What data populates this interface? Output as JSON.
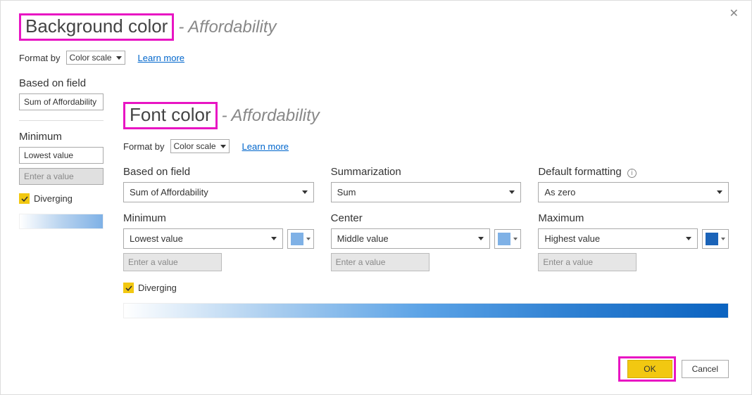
{
  "back": {
    "title_main": "Background color",
    "title_sub": "- Affordability",
    "format_by_label": "Format by",
    "format_by_value": "Color scale",
    "learn_more": "Learn more",
    "based_on_field_label": "Based on field",
    "based_on_field_value": "Sum of Affordability",
    "minimum_label": "Minimum",
    "minimum_value": "Lowest value",
    "minimum_placeholder": "Enter a value",
    "diverging_label": "Diverging"
  },
  "front": {
    "title_main": "Font color",
    "title_sub": "- Affordability",
    "format_by_label": "Format by",
    "format_by_value": "Color scale",
    "learn_more": "Learn more",
    "based_on_field_label": "Based on field",
    "based_on_field_value": "Sum of Affordability",
    "summarization_label": "Summarization",
    "summarization_value": "Sum",
    "default_fmt_label": "Default formatting",
    "default_fmt_value": "As zero",
    "minimum_label": "Minimum",
    "minimum_value": "Lowest value",
    "minimum_placeholder": "Enter a value",
    "center_label": "Center",
    "center_value": "Middle value",
    "center_placeholder": "Enter a value",
    "maximum_label": "Maximum",
    "maximum_value": "Highest value",
    "maximum_placeholder": "Enter a value",
    "diverging_label": "Diverging",
    "ok_label": "OK",
    "cancel_label": "Cancel",
    "min_color": "#7fb1e6",
    "center_color": "#7fb1e6",
    "max_color": "#1a63b8"
  }
}
